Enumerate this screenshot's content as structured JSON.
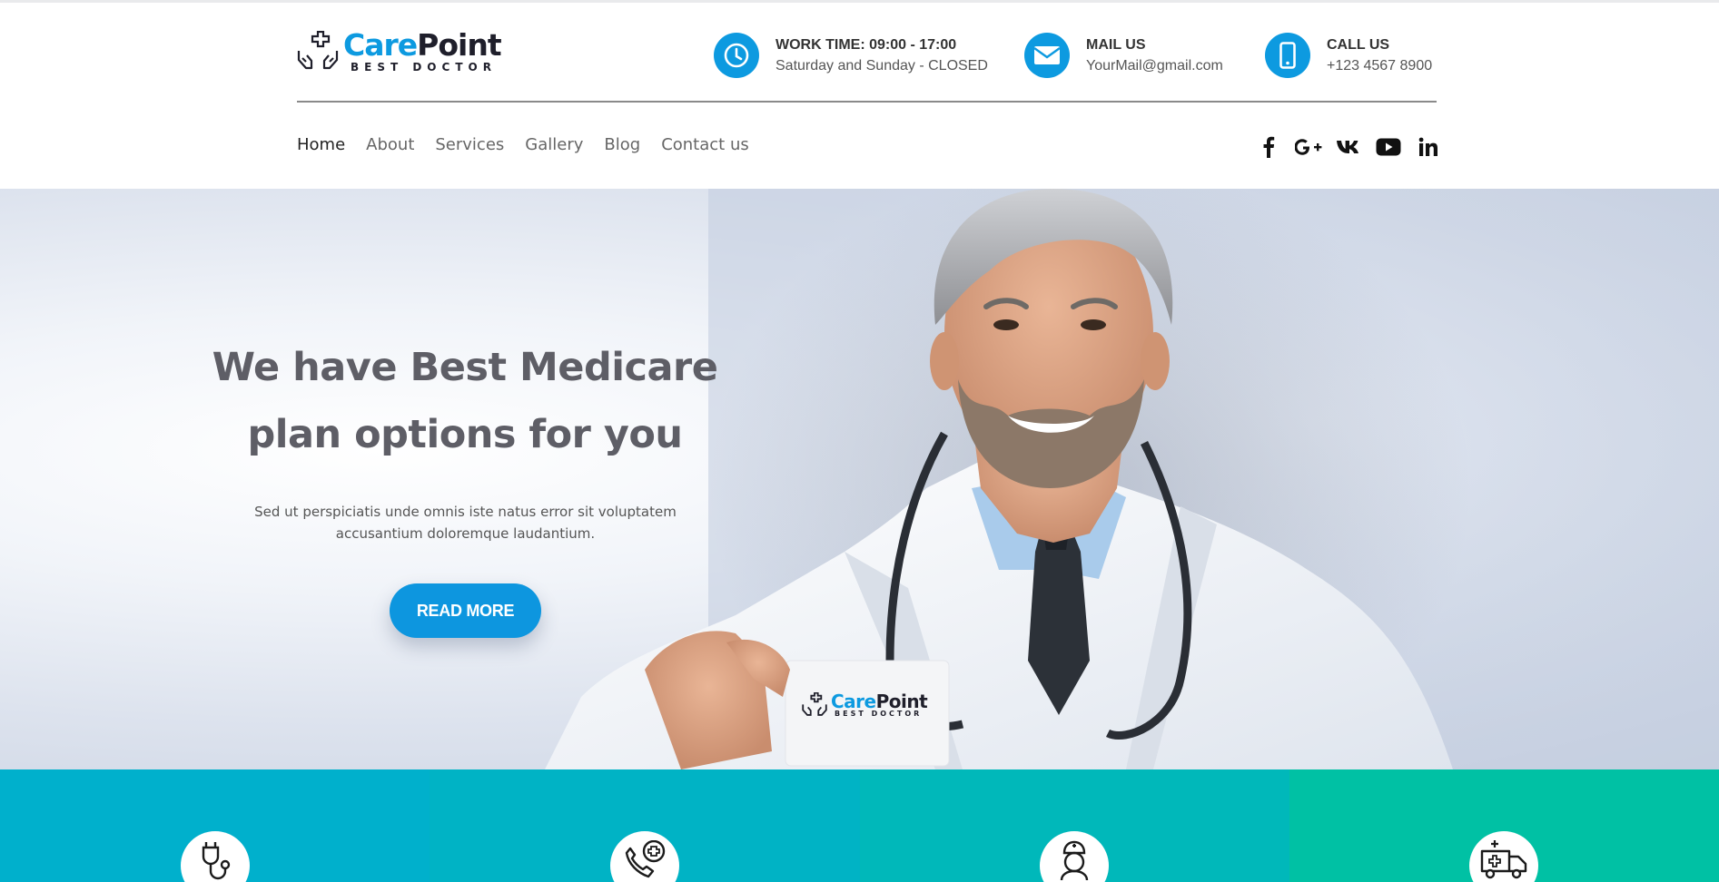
{
  "header": {
    "logo": {
      "name_part1": "Care",
      "name_part2": "Point",
      "tagline": "BEST DOCTOR"
    },
    "info": [
      {
        "icon": "clock-icon",
        "title": "WORK TIME: 09:00 - 17:00",
        "subtitle": "Saturday and Sunday - CLOSED"
      },
      {
        "icon": "mail-icon",
        "title": "MAIL US",
        "subtitle": "YourMail@gmail.com"
      },
      {
        "icon": "phone-icon",
        "title": "CALL US",
        "subtitle": "+123 4567 8900"
      }
    ]
  },
  "nav": {
    "items": [
      "Home",
      "About",
      "Services",
      "Gallery",
      "Blog",
      "Contact us"
    ],
    "active": "Home"
  },
  "social": [
    "facebook-icon",
    "google-plus-icon",
    "vk-icon",
    "youtube-icon",
    "linkedin-icon"
  ],
  "hero": {
    "title_line1": "We have Best Medicare",
    "title_line2": "plan options for you",
    "subtitle_line1": "Sed ut perspiciatis unde omnis iste natus error sit voluptatem",
    "subtitle_line2": "accusantium doloremque laudantium.",
    "button": "READ MORE",
    "card": {
      "name_part1": "Care",
      "name_part2": "Point",
      "tagline": "BEST DOCTOR"
    }
  },
  "features": [
    {
      "icon": "stethoscope-icon",
      "color": "#00b0cc"
    },
    {
      "icon": "phone-medical-icon",
      "color": "#00b3c5"
    },
    {
      "icon": "nurse-icon",
      "color": "#00b8ba"
    },
    {
      "icon": "ambulance-icon",
      "color": "#00c1a4"
    }
  ],
  "colors": {
    "accent": "#0d9ae0",
    "text_dark": "#1f1f2b"
  }
}
